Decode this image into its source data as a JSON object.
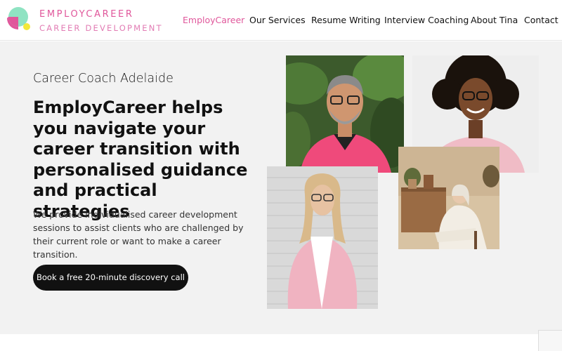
{
  "brand": {
    "name": "EMPLOYCAREER",
    "tagline": "CAREER DEVELOPMENT",
    "colors": {
      "pink": "#e0579b",
      "mint": "#8fe3c2",
      "yellow": "#f3e83a"
    }
  },
  "nav": {
    "items": [
      {
        "label": "EmployCareer",
        "active": true
      },
      {
        "label": "Our Services",
        "active": false
      },
      {
        "label": "Resume Writing",
        "active": false
      },
      {
        "label": "Interview Coaching",
        "active": false
      },
      {
        "label": "About Tina",
        "active": false
      },
      {
        "label": "Contact",
        "active": false
      }
    ]
  },
  "hero": {
    "eyebrow": "Career Coach Adelaide",
    "headline": "EmployCareer helps you navigate your career transition with personalised guidance and practical strategies",
    "description": "We provide individualised career development sessions to assist clients who are challenged by their current role or want to make a career transition.",
    "cta_label": "Book a free 20-minute discovery call"
  },
  "photos": [
    {
      "subject": "man-pink-sweater"
    },
    {
      "subject": "woman-curly-hair"
    },
    {
      "subject": "woman-pink-blazer"
    },
    {
      "subject": "woman-seated-white"
    }
  ]
}
